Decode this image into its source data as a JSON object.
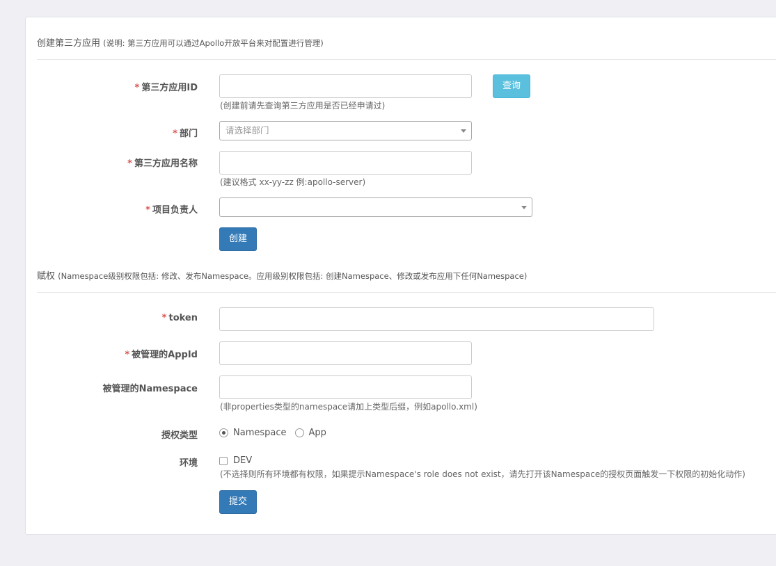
{
  "create_section": {
    "title": "创建第三方应用",
    "note": "(说明: 第三方应用可以通过Apollo开放平台来对配置进行管理)",
    "app_id": {
      "label": "第三方应用ID",
      "value": "",
      "help": "(创建前请先查询第三方应用是否已经申请过)"
    },
    "query_button": "查询",
    "department": {
      "label": "部门",
      "placeholder": "请选择部门"
    },
    "app_name": {
      "label": "第三方应用名称",
      "value": "",
      "help": "(建议格式 xx-yy-zz 例:apollo-server)"
    },
    "owner": {
      "label": "项目负责人",
      "value": ""
    },
    "create_button": "创建"
  },
  "grant_section": {
    "title": "赋权",
    "note": "(Namespace级别权限包括: 修改、发布Namespace。应用级别权限包括: 创建Namespace、修改或发布应用下任何Namespace)",
    "token": {
      "label": "token",
      "value": ""
    },
    "managed_appid": {
      "label": "被管理的AppId",
      "value": ""
    },
    "managed_namespace": {
      "label": "被管理的Namespace",
      "value": "",
      "help": "(非properties类型的namespace请加上类型后缀，例如apollo.xml)"
    },
    "grant_type": {
      "label": "授权类型",
      "options": [
        "Namespace",
        "App"
      ],
      "selected": "Namespace"
    },
    "env": {
      "label": "环境",
      "options": [
        "DEV"
      ],
      "help": "(不选择则所有环境都有权限，如果提示Namespace's role does not exist，请先打开该Namespace的授权页面触发一下权限的初始化动作)"
    },
    "submit_button": "提交"
  },
  "required_mark": "*"
}
